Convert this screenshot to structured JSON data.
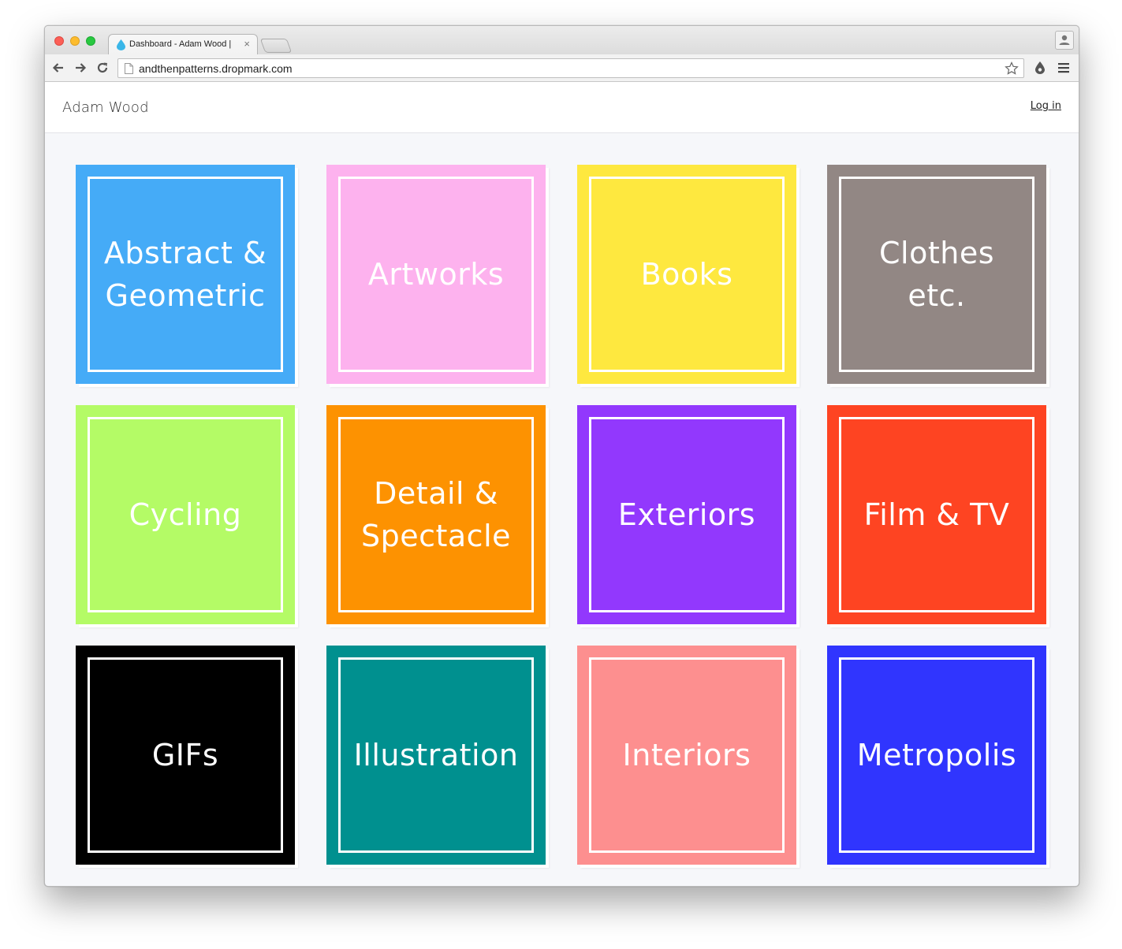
{
  "browser": {
    "tab_title": "Dashboard - Adam Wood |",
    "tab_close": "×",
    "url": "andthenpatterns.dropmark.com"
  },
  "header": {
    "site_title": "Adam Wood",
    "login": "Log in"
  },
  "collections": [
    {
      "label": "Abstract & Geometric",
      "color": "#45abf7"
    },
    {
      "label": "Artworks",
      "color": "#fdb2ee"
    },
    {
      "label": "Books",
      "color": "#fee83f"
    },
    {
      "label": "Clothes etc.",
      "color": "#928784"
    },
    {
      "label": "Cycling",
      "color": "#b4fb66"
    },
    {
      "label": "Detail & Spectacle",
      "color": "#fd9201"
    },
    {
      "label": "Exteriors",
      "color": "#9238fd"
    },
    {
      "label": "Film & TV",
      "color": "#fe4422"
    },
    {
      "label": "GIFs",
      "color": "#000000"
    },
    {
      "label": "Illustration",
      "color": "#00908f"
    },
    {
      "label": "Interiors",
      "color": "#fd8f8f"
    },
    {
      "label": "Metropolis",
      "color": "#3035fe"
    }
  ]
}
